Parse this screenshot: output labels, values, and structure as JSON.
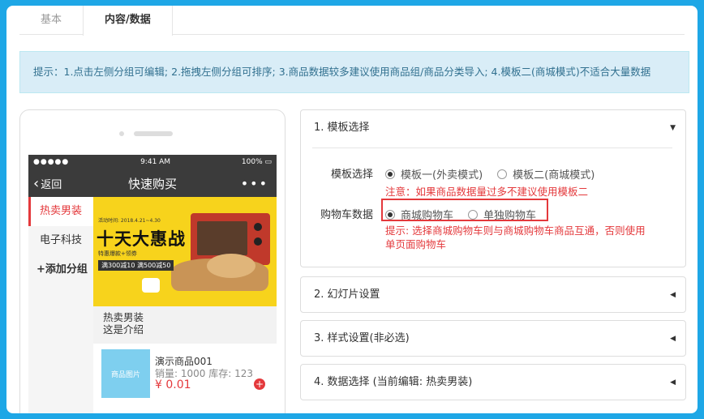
{
  "tabs": [
    {
      "label": "基本"
    },
    {
      "label": "内容/数据"
    }
  ],
  "tip": "提示：1.点击左侧分组可编辑; 2.拖拽左侧分组可排序; 3.商品数据较多建议使用商品组/商品分类导入; 4.模板二(商城模式)不适合大量数据",
  "phone": {
    "status": {
      "signal": "●●●●● ",
      "time": "9:41 AM",
      "battery": "100% ▭"
    },
    "nav": {
      "back": "返回",
      "title": "快速购买",
      "more": "•••"
    },
    "categories": [
      "热卖男装",
      "电子科技",
      "+添加分组"
    ],
    "banner": {
      "date": "活动时间: 2018.4.21~4.30",
      "headline": "十天大惠战",
      "sub": "特惠爆款+领券",
      "pill": "满300减10 满500减50"
    },
    "section": {
      "title": "热卖男装",
      "desc": "这是介绍"
    },
    "product": {
      "thumb": "商品图片",
      "name": "演示商品001",
      "meta": "销量: 1000 库存: 123",
      "price": "¥ 0.01",
      "plus": "+"
    }
  },
  "panel1": {
    "title": "1. 模板选择",
    "template_label": "模板选择",
    "template_options": [
      "模板一(外卖模式)",
      "模板二(商城模式)"
    ],
    "template_selected": 0,
    "note": "注意：如果商品数据量过多不建议使用模板二",
    "cart_label": "购物车数据",
    "cart_options": [
      "商城购物车",
      "单独购物车"
    ],
    "cart_selected": 0,
    "hint_line1": "提示: 选择商城购物车则与商城购物车商品互通，否则使用",
    "hint_line2": "单页面购物车"
  },
  "panel2": {
    "title": "2. 幻灯片设置"
  },
  "panel3": {
    "title": "3. 样式设置(非必选)"
  },
  "panel4": {
    "title": "4. 数据选择 (当前编辑: 热卖男装)"
  },
  "colors": {
    "accent_red": "#e4393c",
    "frame_blue": "#1ea7e6",
    "tip_bg": "#d9edf7",
    "navbar": "#3b3b3b",
    "banner_yellow": "#f7d31c"
  }
}
